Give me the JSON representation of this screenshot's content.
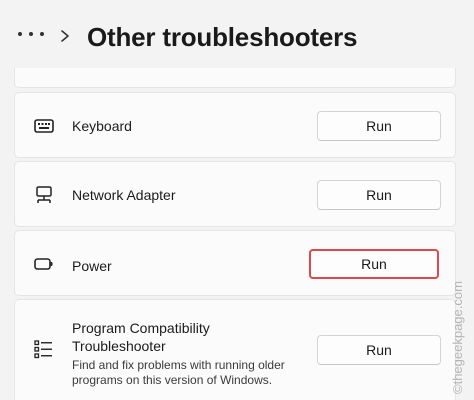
{
  "header": {
    "more_label": "More",
    "title": "Other troubleshooters"
  },
  "troubleshooters": [
    {
      "label": "Keyboard",
      "icon": "keyboard-icon",
      "button": "Run"
    },
    {
      "label": "Network Adapter",
      "icon": "network-adapter-icon",
      "button": "Run"
    },
    {
      "label": "Power",
      "icon": "battery-icon",
      "button": "Run",
      "highlighted": true
    },
    {
      "label_line1": "Program Compatibility",
      "label_line2": "Troubleshooter",
      "description": "Find and fix problems with running older programs on this version of Windows.",
      "icon": "list-icon",
      "button": "Run"
    }
  ],
  "colors": {
    "background": "#f3f3f3",
    "card": "#fbfbfb",
    "highlight": "#e0474c"
  },
  "watermark": "©thegeekpage.com"
}
